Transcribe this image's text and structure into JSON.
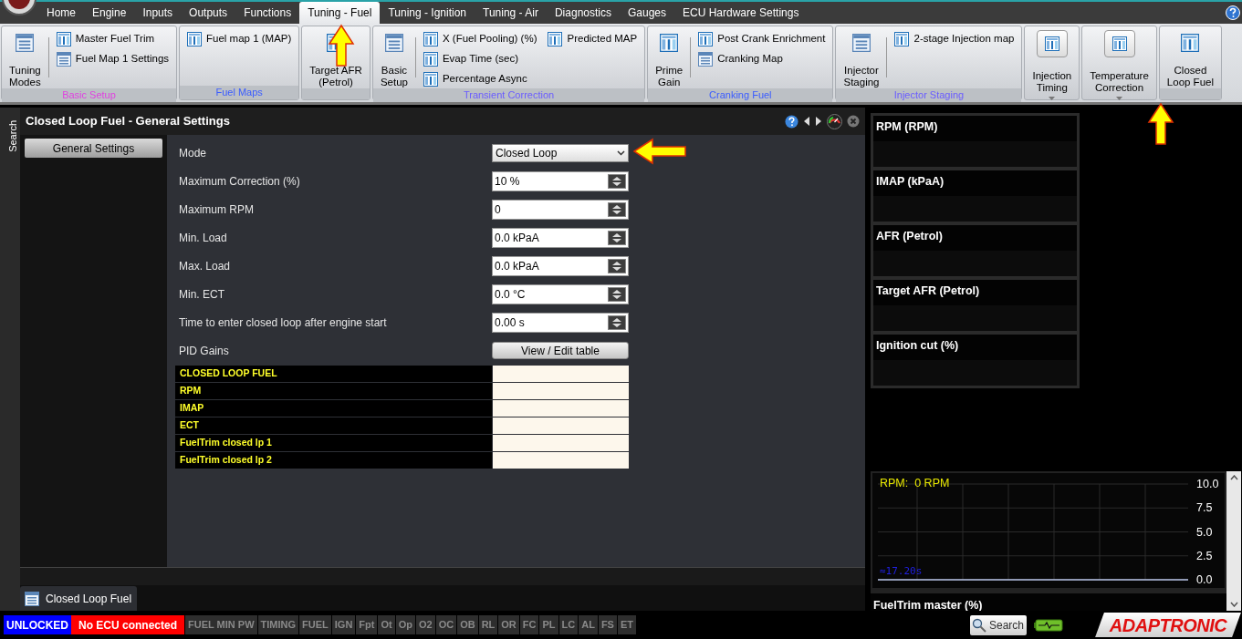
{
  "menu_tabs": [
    {
      "label": "Home",
      "selected": false
    },
    {
      "label": "Engine",
      "selected": false
    },
    {
      "label": "Inputs",
      "selected": false
    },
    {
      "label": "Outputs",
      "selected": false
    },
    {
      "label": "Functions",
      "selected": false
    },
    {
      "label": "Tuning - Fuel",
      "selected": true
    },
    {
      "label": "Tuning - Ignition",
      "selected": false
    },
    {
      "label": "Tuning - Air",
      "selected": false
    },
    {
      "label": "Diagnostics",
      "selected": false
    },
    {
      "label": "Gauges",
      "selected": false
    },
    {
      "label": "ECU Hardware Settings",
      "selected": false
    }
  ],
  "ribbon": [
    {
      "label": "Basic Setup",
      "color": "#e040e0",
      "large": [
        {
          "kind": "list",
          "label": "Tuning\nModes"
        }
      ],
      "columns": [
        [
          {
            "kind": "table",
            "label": "Master Fuel Trim"
          },
          {
            "kind": "list",
            "label": "Fuel Map 1 Settings"
          }
        ]
      ]
    },
    {
      "label": "Fuel Maps",
      "color": "#3a5cff",
      "columns": [
        [
          {
            "kind": "table",
            "label": "Fuel map 1 (MAP)"
          }
        ]
      ]
    },
    {
      "large": [
        {
          "kind": "table",
          "label": "Target AFR\n(Petrol)"
        }
      ]
    },
    {
      "label": "Transient Correction",
      "color": "#6a5cff",
      "large": [
        {
          "kind": "list",
          "label": "Basic\nSetup"
        }
      ],
      "columns": [
        [
          {
            "kind": "table",
            "label": "X (Fuel Pooling) (%)"
          },
          {
            "kind": "table",
            "label": "Evap Time (sec)"
          },
          {
            "kind": "table",
            "label": "Percentage Async"
          }
        ],
        [
          {
            "kind": "table",
            "label": "Predicted MAP"
          }
        ]
      ]
    },
    {
      "label": "Cranking Fuel",
      "color": "#3a5cff",
      "large": [
        {
          "kind": "table",
          "label": "Prime\nGain"
        }
      ],
      "columns": [
        [
          {
            "kind": "table",
            "label": "Post Crank Enrichment"
          },
          {
            "kind": "list",
            "label": "Cranking Map"
          }
        ]
      ]
    },
    {
      "label": "Injector Staging",
      "color": "#6a5cff",
      "large": [
        {
          "kind": "list",
          "label": "Injector\nStaging"
        }
      ],
      "columns": [
        [
          {
            "kind": "table",
            "label": "2-stage Injection map"
          }
        ]
      ]
    },
    {
      "large": [
        {
          "kind": "dropdown",
          "label": "Injection\nTiming"
        }
      ]
    },
    {
      "large": [
        {
          "kind": "dropdown",
          "label": "Temperature\nCorrection"
        }
      ]
    },
    {
      "large": [
        {
          "kind": "table",
          "label": "Closed\nLoop Fuel"
        }
      ]
    }
  ],
  "side_tab": "Search",
  "panel": {
    "title": "Closed Loop Fuel - General Settings",
    "nav": [
      "General Settings"
    ],
    "settings": [
      {
        "kind": "select",
        "label": "Mode",
        "value": "Closed Loop"
      },
      {
        "kind": "spin",
        "label": "Maximum Correction (%)",
        "value": "10 %"
      },
      {
        "kind": "spin",
        "label": "Maximum RPM",
        "value": "0"
      },
      {
        "kind": "spin",
        "label": "Min. Load",
        "value": "0.0 kPaA"
      },
      {
        "kind": "spin",
        "label": "Max. Load",
        "value": "0.0 kPaA"
      },
      {
        "kind": "spin",
        "label": "Min. ECT",
        "value": "0.0 °C"
      },
      {
        "kind": "spin",
        "label": "Time to enter closed loop after engine start",
        "value": "0.00 s"
      },
      {
        "kind": "button",
        "label": "PID Gains",
        "value": "View / Edit table"
      }
    ],
    "table": [
      "CLOSED LOOP FUEL",
      "RPM",
      "IMAP",
      "ECT",
      "FuelTrim closed lp 1",
      "FuelTrim closed lp 2"
    ]
  },
  "doc_tab": "Closed Loop Fuel",
  "gauges": [
    "RPM (RPM)",
    "IMAP  (kPaA)",
    "AFR (Petrol)",
    "Target AFR (Petrol)",
    "Ignition cut (%)"
  ],
  "chart": {
    "title": "RPM:  0 RPM",
    "y_labels": [
      "10.0",
      "7.5",
      "5.0",
      "2.5",
      "0.0"
    ],
    "time_window": "≈17.20s"
  },
  "gauge_below": "FuelTrim master (%)",
  "status": {
    "lock": "UNLOCKED",
    "connection": "No ECU connected",
    "flags": [
      "FUEL MIN PW",
      "TIMING",
      "FUEL",
      "IGN",
      "Fpt",
      "Ot",
      "Op",
      "O2",
      "OC",
      "OB",
      "RL",
      "OR",
      "FC",
      "PL",
      "LC",
      "AL",
      "FS",
      "ET"
    ],
    "search": "Search",
    "logo": "ADAPTRONIC"
  }
}
